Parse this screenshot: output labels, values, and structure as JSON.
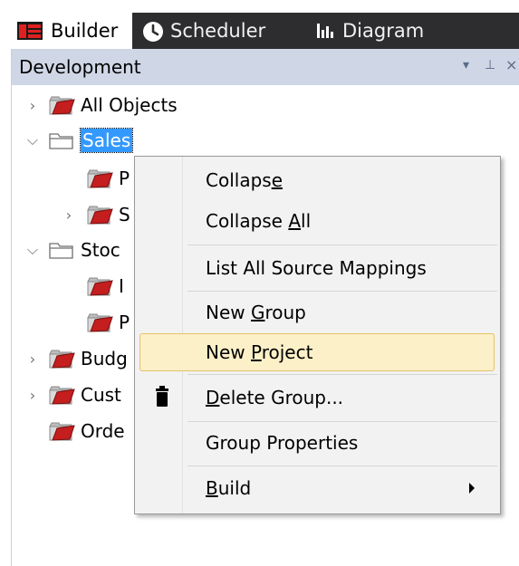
{
  "tabs": [
    {
      "label": "Builder",
      "icon": "builder-icon"
    },
    {
      "label": "Scheduler",
      "icon": "clock-icon"
    },
    {
      "label": "Diagram",
      "icon": "bar-chart-icon"
    }
  ],
  "panel": {
    "title": "Development",
    "buttons": {
      "dropdown": "▾",
      "pin": "⊥",
      "close": "×"
    }
  },
  "tree": [
    {
      "label": "All Objects",
      "expanded": false
    },
    {
      "label": "Sales",
      "expanded": true,
      "selected": true
    },
    {
      "label": "P"
    },
    {
      "label": "S",
      "expanded": false
    },
    {
      "label": "Stoc",
      "expanded": true
    },
    {
      "label": "I"
    },
    {
      "label": "P"
    },
    {
      "label": "Budg",
      "expanded": false
    },
    {
      "label": "Cust",
      "expanded": false
    },
    {
      "label": "Orde"
    }
  ],
  "menu": {
    "items": [
      {
        "label": "Collapse",
        "mnemonic": "e"
      },
      {
        "label": "Collapse All",
        "mnemonic": "A"
      },
      {
        "label": "List All Source Mappings"
      },
      {
        "label": "New Group",
        "mnemonic": "G"
      },
      {
        "label": "New Project",
        "mnemonic": "P",
        "highlighted": true
      },
      {
        "label": "Delete Group...",
        "mnemonic": "D",
        "icon": "trash-icon"
      },
      {
        "label": "Group Properties"
      },
      {
        "label": "Build",
        "mnemonic": "B",
        "submenu": true
      }
    ]
  },
  "colors": {
    "tabbar": "#2d2d30",
    "panel_title": "#cfd6e5",
    "selection": "#3399ff",
    "menu_highlight": "#fcf0c8",
    "folder_red": "#c41e1e"
  }
}
